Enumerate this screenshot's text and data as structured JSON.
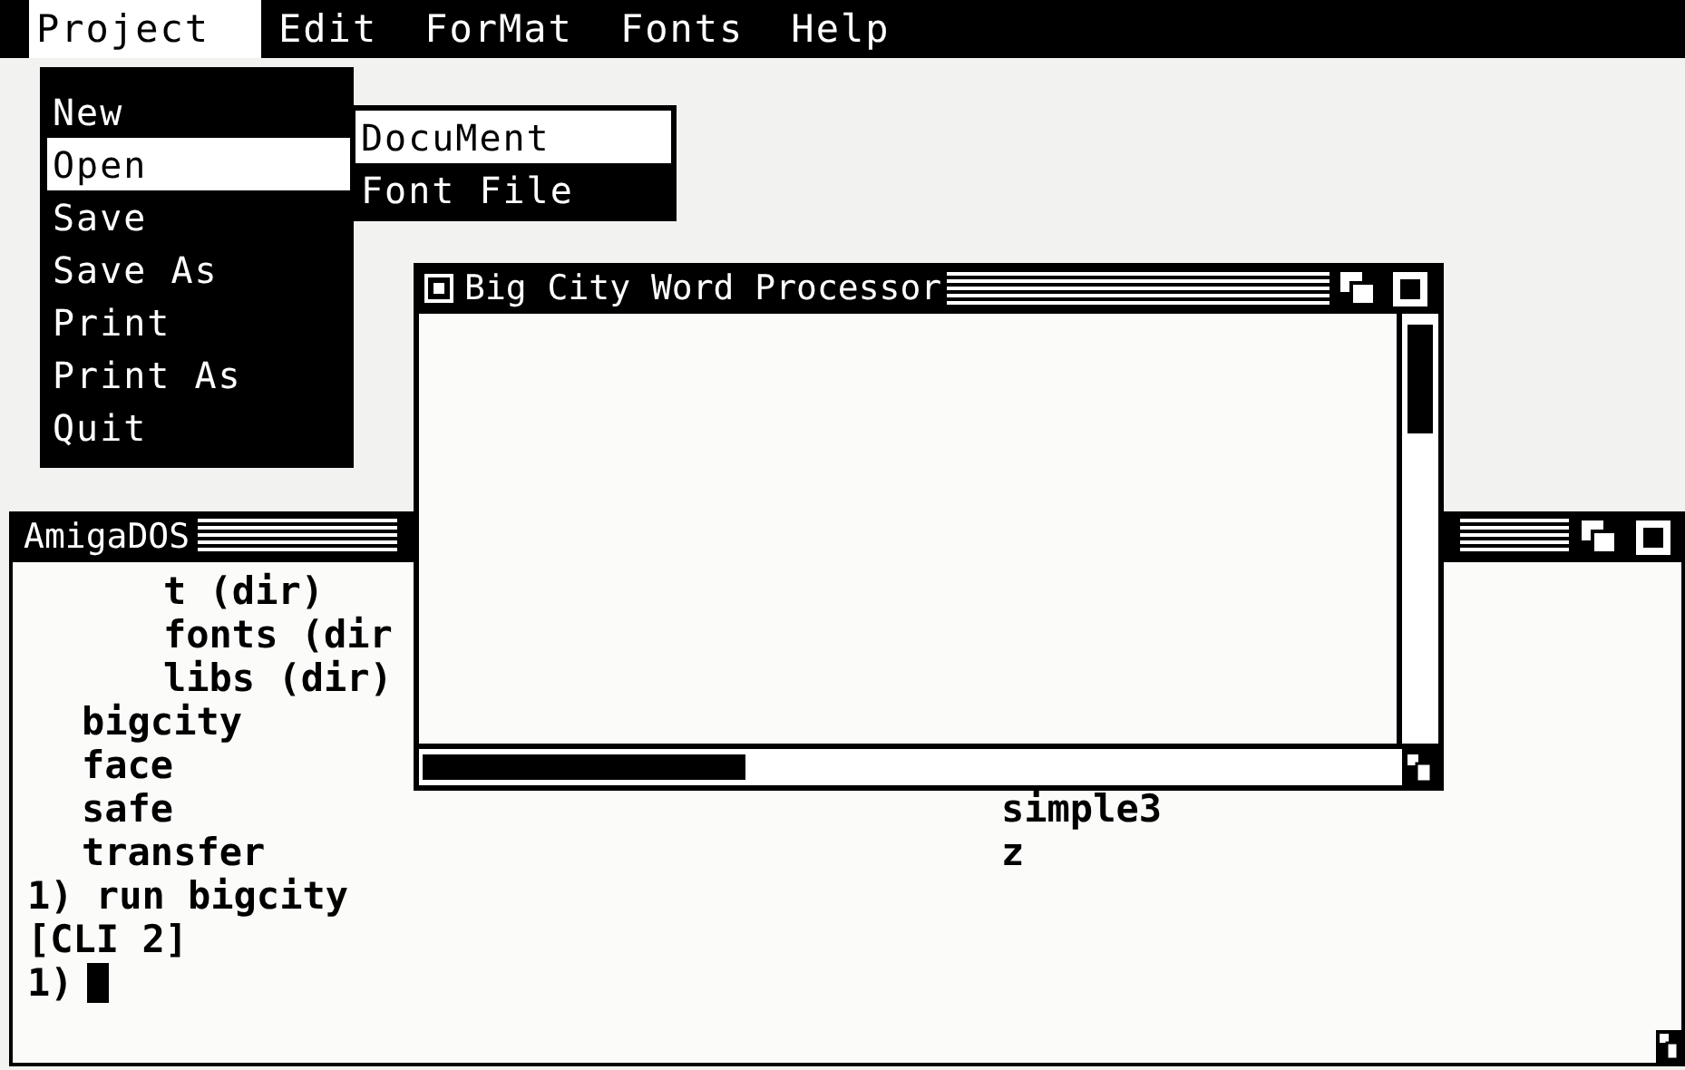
{
  "menu_bar": {
    "menus": [
      {
        "label": "Project",
        "selected": true
      },
      {
        "label": "Edit",
        "selected": false
      },
      {
        "label": "ForMat",
        "selected": false
      },
      {
        "label": "Fonts",
        "selected": false
      },
      {
        "label": "Help",
        "selected": false
      }
    ]
  },
  "menu": {
    "items": [
      {
        "label": "New",
        "selected": false
      },
      {
        "label": "Open",
        "selected": true
      },
      {
        "label": "Save",
        "selected": false
      },
      {
        "label": "Save As",
        "selected": false
      },
      {
        "label": "Print",
        "selected": false
      },
      {
        "label": "Print As",
        "selected": false
      },
      {
        "label": "Quit",
        "selected": false
      }
    ]
  },
  "submenu": {
    "items": [
      {
        "label": "DocuMent",
        "selected": true
      },
      {
        "label": "Font File",
        "selected": false
      }
    ]
  },
  "dos_window": {
    "title": "AmigaDOS",
    "lines": [
      {
        "kind": "dir_entry",
        "text": "t (dir)"
      },
      {
        "kind": "dir_entry",
        "text": "fonts (dir"
      },
      {
        "kind": "dir_entry",
        "text": "libs (dir)"
      },
      {
        "kind": "file",
        "text": "bigcity"
      },
      {
        "kind": "file",
        "text": "face"
      },
      {
        "kind": "file",
        "text": "safe",
        "right": "simple3"
      },
      {
        "kind": "file",
        "text": "transfer",
        "right": "z"
      },
      {
        "kind": "output",
        "text": "1) run bigcity"
      },
      {
        "kind": "output",
        "text": "[CLI 2]"
      },
      {
        "kind": "prompt",
        "text": "1)"
      }
    ]
  },
  "app_window": {
    "title": "Big City Word Processor"
  }
}
